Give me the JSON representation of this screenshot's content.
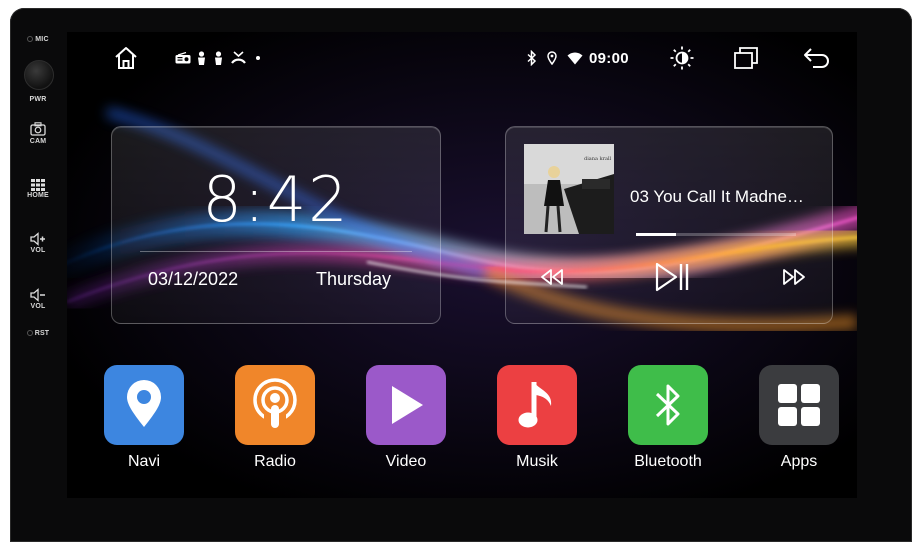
{
  "side_panel": {
    "mic": "MIC",
    "pwr": "PWR",
    "cam": "CAM",
    "home": "HOME",
    "vol_up": "VOL",
    "vol_down": "VOL",
    "rst": "RST"
  },
  "status_bar": {
    "time": "09:00",
    "icons": [
      "home-icon",
      "radio-icon",
      "person-icon",
      "person-icon",
      "phone-missed-icon",
      "dot-icon",
      "bluetooth-icon",
      "location-icon",
      "wifi-icon",
      "brightness-icon",
      "recent-apps-icon",
      "back-icon"
    ]
  },
  "clock_widget": {
    "time": "8:42",
    "date": "03/12/2022",
    "weekday": "Thursday"
  },
  "media_widget": {
    "track": "03 You Call It Madne…",
    "progress": 0.25,
    "album_art_text": "diana krall"
  },
  "apps": [
    {
      "label": "Navi",
      "icon": "location-pin-icon",
      "color": "#3d86e0"
    },
    {
      "label": "Radio",
      "icon": "podcast-icon",
      "color": "#f0862a"
    },
    {
      "label": "Video",
      "icon": "play-icon",
      "color": "#9b59c9"
    },
    {
      "label": "Musik",
      "icon": "music-note-icon",
      "color": "#ec4042"
    },
    {
      "label": "Bluetooth",
      "icon": "bluetooth-icon",
      "color": "#3fbd4a"
    },
    {
      "label": "Apps",
      "icon": "grid-icon",
      "color": "#3b3c3f"
    }
  ]
}
